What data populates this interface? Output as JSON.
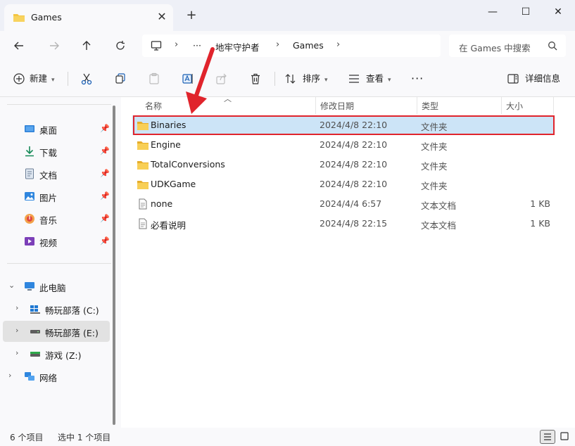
{
  "window": {
    "tab_title": "Games",
    "tab_close": "✕",
    "new_tab": "+",
    "minimize": "—",
    "maximize": "☐",
    "close": "✕"
  },
  "address": {
    "more": "···",
    "segments": [
      "地牢守护者",
      "Games"
    ],
    "separator": "›",
    "search_placeholder": "在 Games 中搜索"
  },
  "toolbar": {
    "new_label": "新建",
    "sort_label": "排序",
    "view_label": "查看",
    "more": "···",
    "details_label": "详细信息"
  },
  "sidebar": {
    "quick": [
      {
        "label": "桌面",
        "icon": "desktop-icon"
      },
      {
        "label": "下载",
        "icon": "download-icon"
      },
      {
        "label": "文档",
        "icon": "document-icon"
      },
      {
        "label": "图片",
        "icon": "pictures-icon"
      },
      {
        "label": "音乐",
        "icon": "music-icon"
      },
      {
        "label": "视频",
        "icon": "video-icon"
      }
    ],
    "this_pc": "此电脑",
    "drives": [
      {
        "label": "畅玩部落 (C:)",
        "icon": "windows-drive-icon"
      },
      {
        "label": "畅玩部落 (E:)",
        "icon": "drive-icon"
      },
      {
        "label": "游戏 (Z:)",
        "icon": "drive-icon"
      }
    ],
    "network": "网络"
  },
  "columns": {
    "name": "名称",
    "modified": "修改日期",
    "type": "类型",
    "size": "大小"
  },
  "files": [
    {
      "name": "Binaries",
      "modified": "2024/4/8 22:10",
      "type": "文件夹",
      "size": "",
      "kind": "folder"
    },
    {
      "name": "Engine",
      "modified": "2024/4/8 22:10",
      "type": "文件夹",
      "size": "",
      "kind": "folder"
    },
    {
      "name": "TotalConversions",
      "modified": "2024/4/8 22:10",
      "type": "文件夹",
      "size": "",
      "kind": "folder"
    },
    {
      "name": "UDKGame",
      "modified": "2024/4/8 22:10",
      "type": "文件夹",
      "size": "",
      "kind": "folder"
    },
    {
      "name": "none",
      "modified": "2024/4/4 6:57",
      "type": "文本文档",
      "size": "1 KB",
      "kind": "text"
    },
    {
      "name": "必看说明",
      "modified": "2024/4/8 22:15",
      "type": "文本文档",
      "size": "1 KB",
      "kind": "text"
    }
  ],
  "status": {
    "count": "6 个项目",
    "selected": "选中 1 个项目"
  },
  "colors": {
    "accent": "#0067c0",
    "selection": "#cce4f7",
    "annotation": "#e0242c",
    "folder": "#f4c542"
  }
}
